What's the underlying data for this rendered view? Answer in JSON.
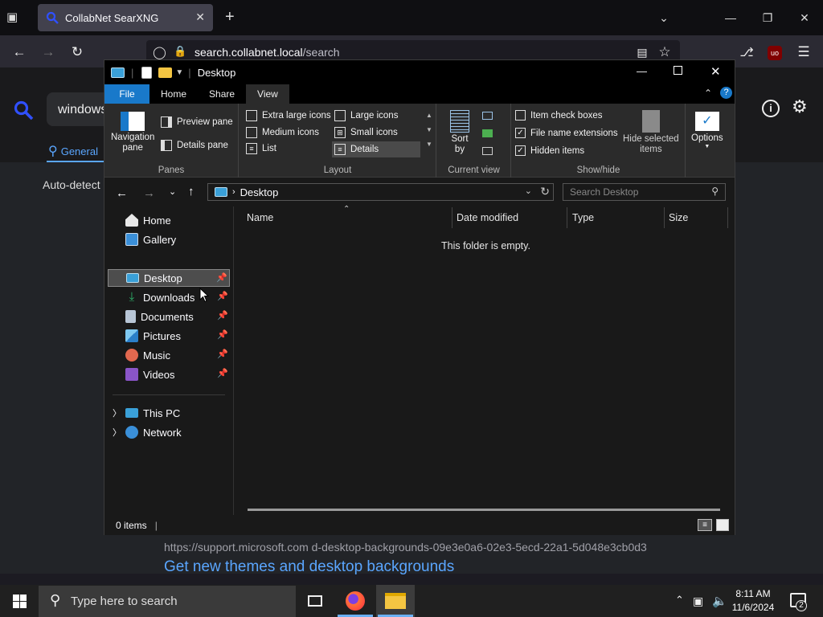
{
  "browser": {
    "tab_title": "CollabNet SearXNG",
    "url_host": "search.collabnet.local",
    "url_path": "/search"
  },
  "searx": {
    "query_fragment": "windows",
    "tab_general": "General",
    "auto_detect": "Auto-detect (",
    "result_url": "https://support.microsoft.com  d-desktop-backgrounds-09e3e0a6-02e3-5ecd-22a1-5d048e3cb0d3",
    "result_title": "Get new themes and desktop backgrounds"
  },
  "explorer": {
    "title": "Desktop",
    "tabs": [
      "File",
      "Home",
      "Share",
      "View"
    ],
    "ribbon": {
      "panes": {
        "label": "Panes",
        "navigation_pane": "Navigation\npane",
        "preview_pane": "Preview pane",
        "details_pane": "Details pane"
      },
      "layout": {
        "label": "Layout",
        "extra_large_icons": "Extra large icons",
        "large_icons": "Large icons",
        "medium_icons": "Medium icons",
        "small_icons": "Small icons",
        "list": "List",
        "details": "Details"
      },
      "current_view": {
        "label": "Current view",
        "sort_by": "Sort\nby"
      },
      "show_hide": {
        "label": "Show/hide",
        "item_check_boxes": "Item check boxes",
        "file_name_extensions": "File name extensions",
        "hidden_items": "Hidden items",
        "hide_selected_items": "Hide selected\nitems"
      },
      "options": "Options"
    },
    "address": {
      "segment": "Desktop",
      "search_placeholder": "Search Desktop"
    },
    "nav": {
      "home": "Home",
      "gallery": "Gallery",
      "desktop": "Desktop",
      "downloads": "Downloads",
      "documents": "Documents",
      "pictures": "Pictures",
      "music": "Music",
      "videos": "Videos",
      "this_pc": "This PC",
      "network": "Network"
    },
    "columns": [
      "Name",
      "Date modified",
      "Type",
      "Size"
    ],
    "empty_message": "This folder is empty.",
    "status": "0 items"
  },
  "taskbar": {
    "search_placeholder": "Type here to search",
    "time": "8:11 AM",
    "date": "11/6/2024",
    "notification_count": "2"
  }
}
